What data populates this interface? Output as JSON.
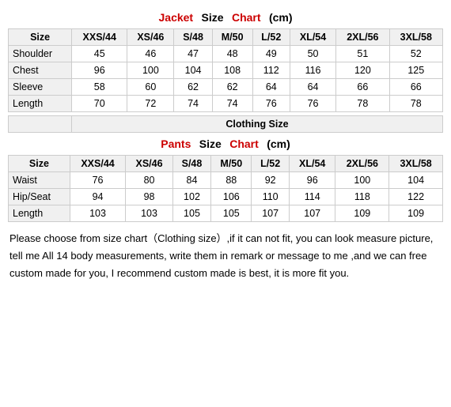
{
  "jacketTitle": {
    "part1": "Jacket",
    "part2": "Size",
    "part3": "Chart",
    "part4": "(cm)"
  },
  "pantsTitle": {
    "part1": "Pants",
    "part2": "Size",
    "part3": "Chart",
    "part4": "(cm)"
  },
  "clothingSizeLabel": "Clothing    Size",
  "jacketHeaders": [
    "Size",
    "XXS/44",
    "XS/46",
    "S/48",
    "M/50",
    "L/52",
    "XL/54",
    "2XL/56",
    "3XL/58"
  ],
  "jacketRows": [
    {
      "label": "Shoulder",
      "values": [
        "45",
        "46",
        "47",
        "48",
        "49",
        "50",
        "51",
        "52"
      ]
    },
    {
      "label": "Chest",
      "values": [
        "96",
        "100",
        "104",
        "108",
        "112",
        "116",
        "120",
        "125"
      ]
    },
    {
      "label": "Sleeve",
      "values": [
        "58",
        "60",
        "62",
        "62",
        "64",
        "64",
        "66",
        "66"
      ]
    },
    {
      "label": "Length",
      "values": [
        "70",
        "72",
        "74",
        "74",
        "76",
        "76",
        "78",
        "78"
      ]
    }
  ],
  "pantsHeaders": [
    "Size",
    "XXS/44",
    "XS/46",
    "S/48",
    "M/50",
    "L/52",
    "XL/54",
    "2XL/56",
    "3XL/58"
  ],
  "pantsRows": [
    {
      "label": "Waist",
      "values": [
        "76",
        "80",
        "84",
        "88",
        "92",
        "96",
        "100",
        "104"
      ]
    },
    {
      "label": "Hip/Seat",
      "values": [
        "94",
        "98",
        "102",
        "106",
        "110",
        "114",
        "118",
        "122"
      ]
    },
    {
      "label": "Length",
      "values": [
        "103",
        "103",
        "105",
        "105",
        "107",
        "107",
        "109",
        "109"
      ]
    }
  ],
  "bottomText": "Please choose from size chart（Clothing size）,if it can not fit, you can look measure picture, tell me All 14 body measurements, write them in remark or message to me ,and we can free custom made for you, I recommend custom made is best, it is more fit you."
}
